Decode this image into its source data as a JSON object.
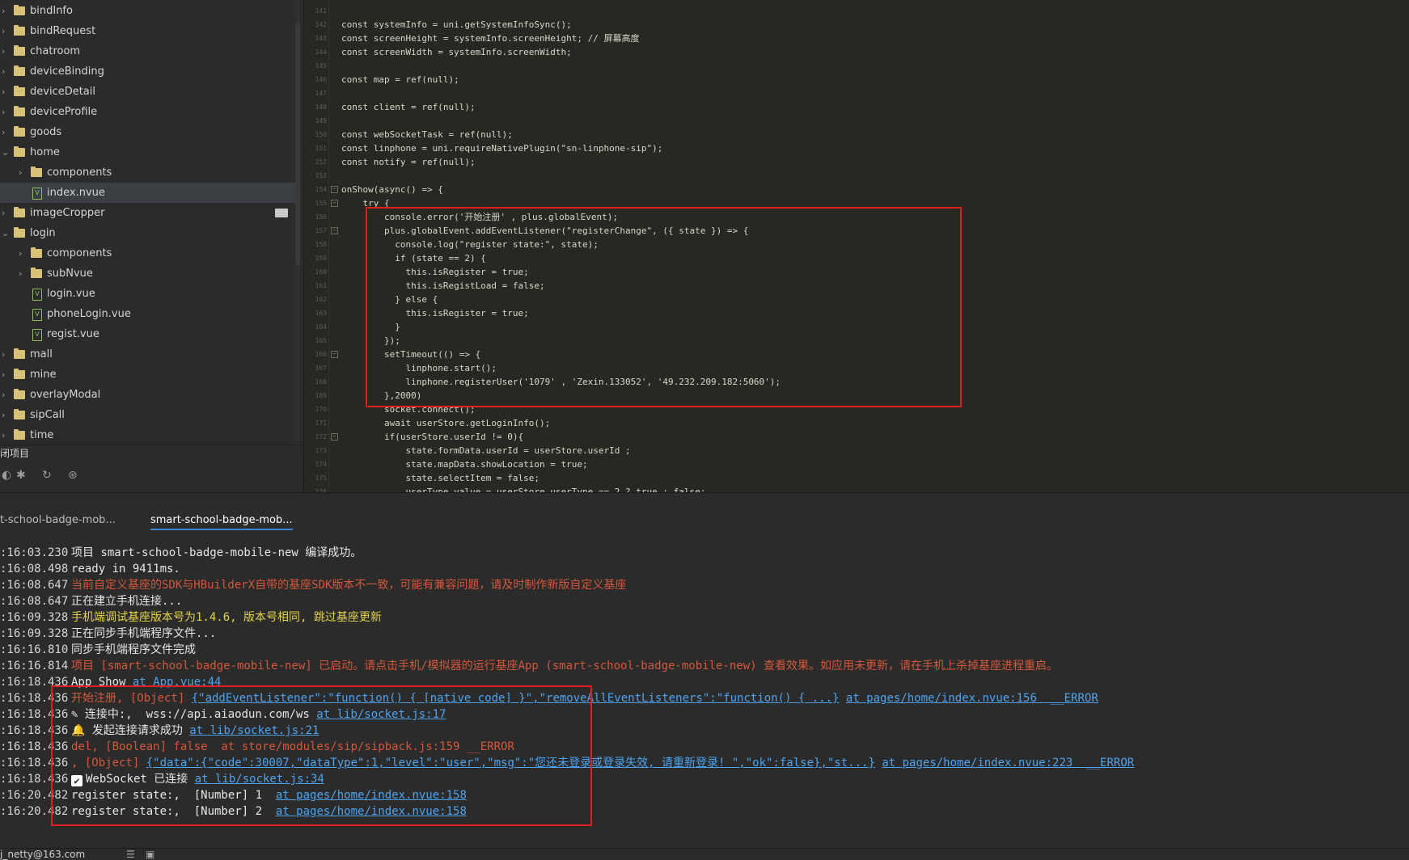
{
  "sidebar": {
    "items": [
      {
        "label": "bindInfo",
        "type": "folder",
        "depth": 0,
        "expanded": false
      },
      {
        "label": "bindRequest",
        "type": "folder",
        "depth": 0,
        "expanded": false
      },
      {
        "label": "chatroom",
        "type": "folder",
        "depth": 0,
        "expanded": false
      },
      {
        "label": "deviceBinding",
        "type": "folder",
        "depth": 0,
        "expanded": false
      },
      {
        "label": "deviceDetail",
        "type": "folder",
        "depth": 0,
        "expanded": false
      },
      {
        "label": "deviceProfile",
        "type": "folder",
        "depth": 0,
        "expanded": false
      },
      {
        "label": "goods",
        "type": "folder",
        "depth": 0,
        "expanded": false
      },
      {
        "label": "home",
        "type": "folder",
        "depth": 0,
        "expanded": true
      },
      {
        "label": "components",
        "type": "folder",
        "depth": 1,
        "expanded": false
      },
      {
        "label": "index.nvue",
        "type": "file",
        "depth": 1,
        "selected": true
      },
      {
        "label": "imageCropper",
        "type": "folder",
        "depth": 0,
        "expanded": false,
        "hover": true
      },
      {
        "label": "login",
        "type": "folder",
        "depth": 0,
        "expanded": true
      },
      {
        "label": "components",
        "type": "folder",
        "depth": 1,
        "expanded": false
      },
      {
        "label": "subNvue",
        "type": "folder",
        "depth": 1,
        "expanded": false
      },
      {
        "label": "login.vue",
        "type": "file",
        "depth": 1
      },
      {
        "label": "phoneLogin.vue",
        "type": "file",
        "depth": 1
      },
      {
        "label": "regist.vue",
        "type": "file",
        "depth": 1
      },
      {
        "label": "mall",
        "type": "folder",
        "depth": 0,
        "expanded": false
      },
      {
        "label": "mine",
        "type": "folder",
        "depth": 0,
        "expanded": false
      },
      {
        "label": "overlayModal",
        "type": "folder",
        "depth": 0,
        "expanded": false
      },
      {
        "label": "sipCall",
        "type": "folder",
        "depth": 0,
        "expanded": false
      },
      {
        "label": "time",
        "type": "folder",
        "depth": 0,
        "expanded": false
      }
    ],
    "section_title": "闭项目",
    "toolbar_icons": [
      "run-icon",
      "debug-icon",
      "refresh-icon",
      "globe-icon"
    ]
  },
  "editor": {
    "lines": [
      {
        "n": "141",
        "code": ""
      },
      {
        "n": "142",
        "code": "const systemInfo = uni.getSystemInfoSync();"
      },
      {
        "n": "143",
        "code": "const screenHeight = systemInfo.screenHeight; // 屏幕高度"
      },
      {
        "n": "144",
        "code": "const screenWidth = systemInfo.screenWidth;"
      },
      {
        "n": "145",
        "code": ""
      },
      {
        "n": "146",
        "code": "const map = ref(null);"
      },
      {
        "n": "147",
        "code": ""
      },
      {
        "n": "148",
        "code": "const client = ref(null);"
      },
      {
        "n": "149",
        "code": ""
      },
      {
        "n": "150",
        "code": "const webSocketTask = ref(null);"
      },
      {
        "n": "151",
        "code": "const linphone = uni.requireNativePlugin(\"sn-linphone-sip\");"
      },
      {
        "n": "152",
        "code": "const notify = ref(null);"
      },
      {
        "n": "153",
        "code": ""
      },
      {
        "n": "154",
        "code": "onShow(async() => {",
        "fold": true
      },
      {
        "n": "155",
        "code": "    try {",
        "fold": true
      },
      {
        "n": "156",
        "code": "        console.error('开始注册' , plus.globalEvent);"
      },
      {
        "n": "157",
        "code": "        plus.globalEvent.addEventListener(\"registerChange\", ({ state }) => {",
        "fold": true
      },
      {
        "n": "158",
        "code": "          console.log(\"register state:\", state);"
      },
      {
        "n": "159",
        "code": "          if (state == 2) {"
      },
      {
        "n": "160",
        "code": "            this.isRegister = true;"
      },
      {
        "n": "161",
        "code": "            this.isRegistLoad = false;"
      },
      {
        "n": "162",
        "code": "          } else {"
      },
      {
        "n": "163",
        "code": "            this.isRegister = true;"
      },
      {
        "n": "164",
        "code": "          }"
      },
      {
        "n": "165",
        "code": "        });"
      },
      {
        "n": "166",
        "code": "        setTimeout(() => {",
        "fold": true
      },
      {
        "n": "167",
        "code": "            linphone.start();"
      },
      {
        "n": "168",
        "code": "            linphone.registerUser('1079' , 'Zexin.133052', '49.232.209.182:5060');"
      },
      {
        "n": "169",
        "code": "        },2000)"
      },
      {
        "n": "170",
        "code": "        socket.connect();"
      },
      {
        "n": "171",
        "code": "        await userStore.getLoginInfo();"
      },
      {
        "n": "172",
        "code": "        if(userStore.userId != 0){",
        "fold": true
      },
      {
        "n": "173",
        "code": "            state.formData.userId = userStore.userId ;"
      },
      {
        "n": "174",
        "code": "            state.mapData.showLocation = true;"
      },
      {
        "n": "175",
        "code": "            state.selectItem = false;"
      },
      {
        "n": "176",
        "code": "            userType.value = userStore.userType == 2 ? true : false;"
      }
    ]
  },
  "bottom_panel": {
    "tabs": [
      {
        "label": "t-school-badge-mob...",
        "active": false
      },
      {
        "label": "smart-school-badge-mob...",
        "active": true
      }
    ],
    "console": [
      {
        "ts": ":16:03.230",
        "segments": [
          {
            "t": "项目 smart-school-badge-mobile-new 编译成功。",
            "c": "normal"
          }
        ]
      },
      {
        "ts": ":16:08.498",
        "segments": [
          {
            "t": "ready in 9411ms.",
            "c": "normal"
          }
        ]
      },
      {
        "ts": ":16:08.647",
        "segments": [
          {
            "t": "当前自定义基座的SDK与HBuilderX自带的基座SDK版本不一致，可能有兼容问题，请及时制作新版自定义基座",
            "c": "warn"
          }
        ]
      },
      {
        "ts": ":16:08.647",
        "segments": [
          {
            "t": "正在建立手机连接...",
            "c": "normal"
          }
        ]
      },
      {
        "ts": ":16:09.328",
        "segments": [
          {
            "t": "手机端调试基座版本号为1.4.6, 版本号相同, 跳过基座更新",
            "c": "yellow"
          }
        ]
      },
      {
        "ts": ":16:09.328",
        "segments": [
          {
            "t": "正在同步手机端程序文件...",
            "c": "normal"
          }
        ]
      },
      {
        "ts": ":16:16.810",
        "segments": [
          {
            "t": "同步手机端程序文件完成",
            "c": "normal"
          }
        ]
      },
      {
        "ts": ":16:16.814",
        "segments": [
          {
            "t": "项目 [smart-school-badge-mobile-new] 已启动。请点击手机/模拟器的运行基座App (smart-school-badge-mobile-new) 查看效果。如应用未更新，请在手机上杀掉基座进程重启。",
            "c": "warn"
          }
        ]
      },
      {
        "ts": ":16:18.436",
        "segments": [
          {
            "t": "App Show ",
            "c": "normal"
          },
          {
            "t": "at App.vue:44",
            "c": "link"
          }
        ]
      },
      {
        "ts": ":16:18.436",
        "segments": [
          {
            "t": "开始注册, [Object] ",
            "c": "warn"
          },
          {
            "t": "{\"addEventListener\":\"function() { [native code] }\",\"removeAllEventListeners\":\"function() { ...}",
            "c": "link"
          },
          {
            "t": " ",
            "c": "normal"
          },
          {
            "t": "at pages/home/index.nvue:156",
            "c": "link"
          },
          {
            "t": "  __ERROR",
            "c": "link"
          }
        ]
      },
      {
        "ts": ":16:18.436",
        "segments": [
          {
            "t": "✎ 连接中:,  wss://api.aiaodun.com/ws ",
            "c": "normal"
          },
          {
            "t": "at lib/socket.js:17",
            "c": "link"
          }
        ]
      },
      {
        "ts": ":16:18.436",
        "segments": [
          {
            "t": "🔔 发起连接请求成功 ",
            "c": "normal"
          },
          {
            "t": "at lib/socket.js:21",
            "c": "link"
          }
        ]
      },
      {
        "ts": ":16:18.436",
        "segments": [
          {
            "t": "del, [Boolean] false  at store/modules/sip/sipback.js:159 __ERROR",
            "c": "err"
          }
        ]
      },
      {
        "ts": ":16:18.436",
        "segments": [
          {
            "t": ", [Object] ",
            "c": "err"
          },
          {
            "t": "{\"data\":{\"code\":30007,\"dataType\":1,\"level\":\"user\",\"msg\":\"您还未登录或登录失效, 请重新登录! \",\"ok\":false},\"st...}",
            "c": "link"
          },
          {
            "t": " ",
            "c": "normal"
          },
          {
            "t": "at pages/home/index.nvue:223",
            "c": "link"
          },
          {
            "t": "  __ERROR",
            "c": "link"
          }
        ]
      },
      {
        "ts": ":16:18.436",
        "check": true,
        "segments": [
          {
            "t": "WebSocket 已连接 ",
            "c": "normal"
          },
          {
            "t": "at lib/socket.js:34",
            "c": "link"
          }
        ]
      },
      {
        "ts": ":16:20.482",
        "segments": [
          {
            "t": "register state:,  [Number] 1  ",
            "c": "normal"
          },
          {
            "t": "at pages/home/index.nvue:158",
            "c": "link"
          }
        ]
      },
      {
        "ts": ":16:20.482",
        "segments": [
          {
            "t": "register state:,  [Number] 2  ",
            "c": "normal"
          },
          {
            "t": "at pages/home/index.nvue:158",
            "c": "link"
          }
        ]
      }
    ]
  },
  "statusbar": {
    "user": "j_netty@163.com",
    "icons": [
      "list-icon",
      "terminal-icon"
    ]
  },
  "colors": {
    "highlight_box": "#e01e1e",
    "link": "#4ea3ef",
    "warn": "#d4573b",
    "yellow": "#e2d34a",
    "active_tab_underline": "#3d86d6"
  }
}
